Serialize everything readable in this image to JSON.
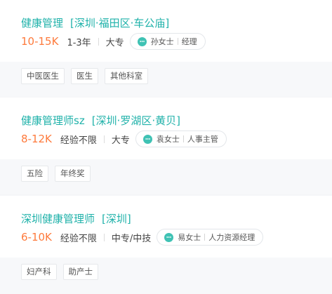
{
  "jobs": [
    {
      "title": "健康管理",
      "location": "[深圳·福田区·车公庙]",
      "salary": "10-15K",
      "experience": "1-3年",
      "education": "大专",
      "contact_name": "孙女士",
      "contact_role": "经理",
      "tags": [
        "中医医生",
        "医生",
        "其他科室"
      ]
    },
    {
      "title": "健康管理师sz",
      "location": "[深圳·罗湖区·黄贝]",
      "salary": "8-12K",
      "experience": "经验不限",
      "education": "大专",
      "contact_name": "袁女士",
      "contact_role": "人事主管",
      "tags": [
        "五险",
        "年终奖"
      ]
    },
    {
      "title": "深圳健康管理师",
      "location": "[深圳]",
      "salary": "6-10K",
      "experience": "经验不限",
      "education": "中专/中技",
      "contact_name": "易女士",
      "contact_role": "人力资源经理",
      "tags": [
        "妇产科",
        "助产士"
      ]
    }
  ],
  "colors": {
    "title": "#20b2aa",
    "salary": "#fe7a3c",
    "chat_icon": "#3fc2b4",
    "tag_bg": "#f7f8fa"
  },
  "icons": {
    "contact": "chat-bubble-icon"
  }
}
